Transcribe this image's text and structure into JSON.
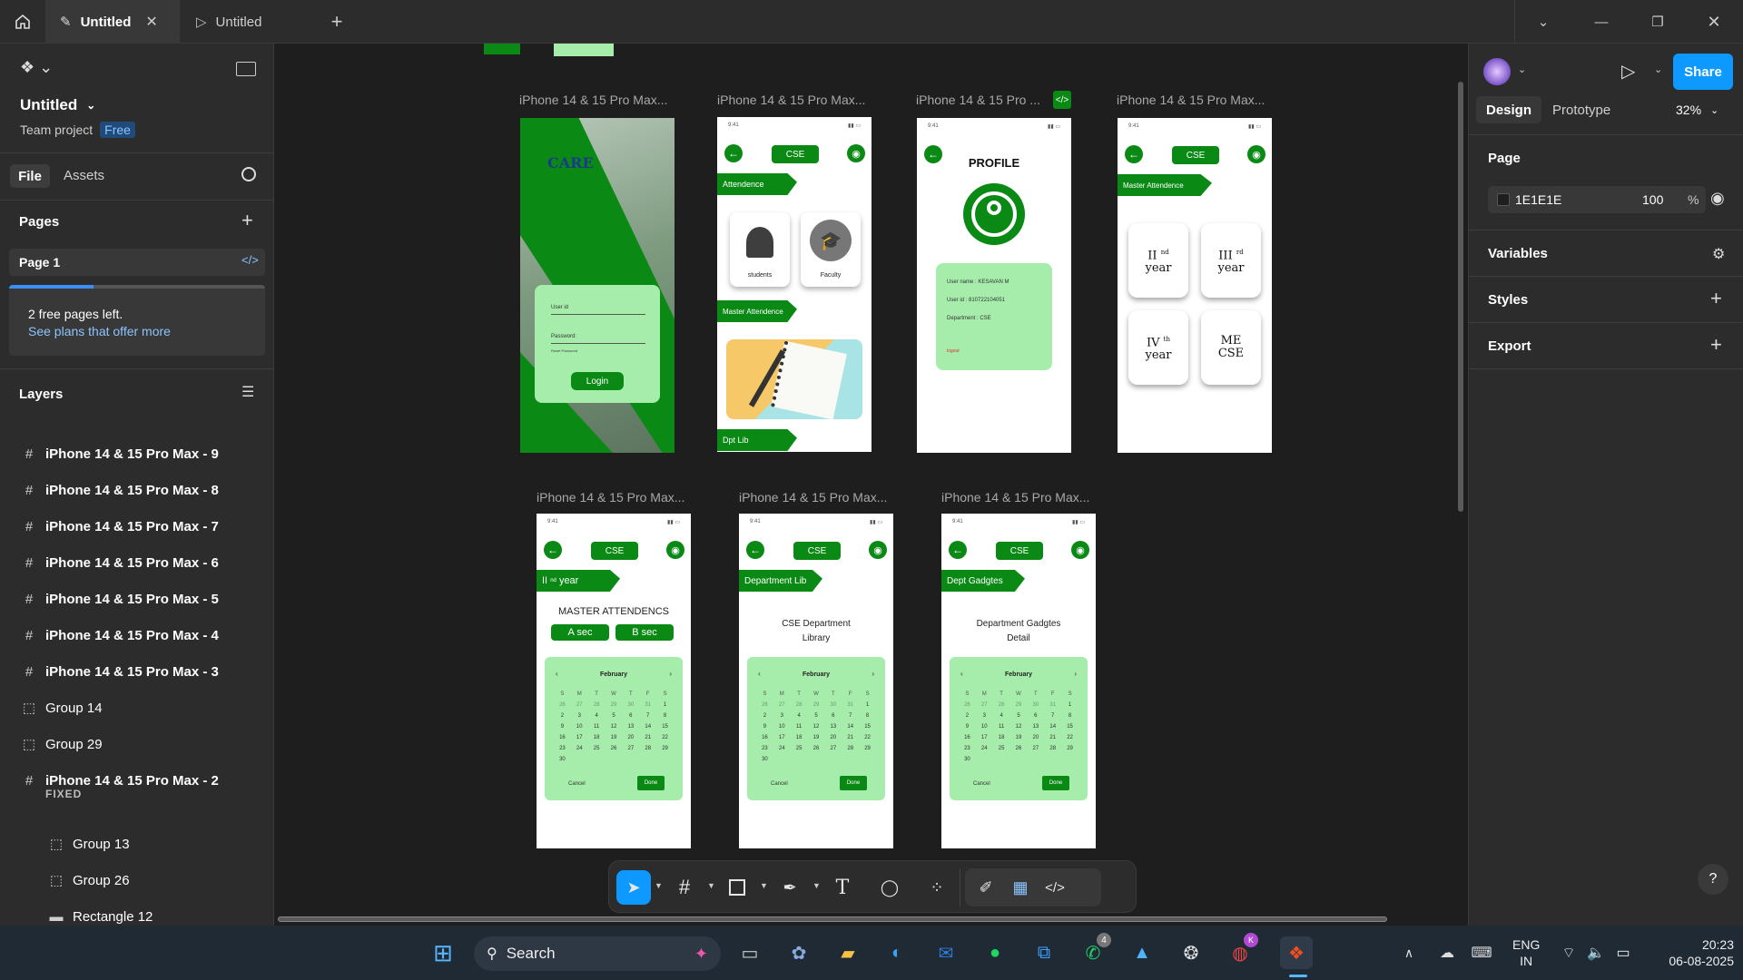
{
  "tabs": [
    {
      "label": "Untitled"
    },
    {
      "label": "Untitled"
    }
  ],
  "file": {
    "name": "Untitled",
    "project": "Team project",
    "plan": "Free",
    "tab_file": "File",
    "tab_assets": "Assets"
  },
  "pages": {
    "title": "Pages",
    "current": "Page 1",
    "banner": "2 free pages left.",
    "banner_link": "See plans that offer more",
    "progress": 0.33
  },
  "layers": {
    "title": "Layers",
    "items": [
      {
        "label": "iPhone 14 & 15 Pro Max - 9",
        "kind": "frame"
      },
      {
        "label": "iPhone 14 & 15 Pro Max - 8",
        "kind": "frame"
      },
      {
        "label": "iPhone 14 & 15 Pro Max - 7",
        "kind": "frame"
      },
      {
        "label": "iPhone 14 & 15 Pro Max - 6",
        "kind": "frame"
      },
      {
        "label": "iPhone 14 & 15 Pro Max - 5",
        "kind": "frame"
      },
      {
        "label": "iPhone 14 & 15 Pro Max - 4",
        "kind": "frame"
      },
      {
        "label": "iPhone 14 & 15 Pro Max - 3",
        "kind": "frame"
      },
      {
        "label": "Group 14",
        "kind": "group"
      },
      {
        "label": "Group 29",
        "kind": "group"
      },
      {
        "label": "iPhone 14 & 15 Pro Max - 2",
        "kind": "frame"
      }
    ],
    "fixed_label": "FIXED",
    "children": [
      {
        "label": "Group 13",
        "kind": "group"
      },
      {
        "label": "Group 26",
        "kind": "group"
      },
      {
        "label": "Rectangle 12",
        "kind": "rect"
      }
    ]
  },
  "right": {
    "share": "Share",
    "tab_design": "Design",
    "tab_prototype": "Prototype",
    "zoom": "32%",
    "page_title": "Page",
    "bg_color": "1E1E1E",
    "opacity": "100",
    "percent": "%",
    "variables": "Variables",
    "styles": "Styles",
    "export": "Export",
    "help": "?"
  },
  "canvas": {
    "labels": [
      "iPhone 14 & 15 Pro Max...",
      "iPhone 14 & 15 Pro Max...",
      "iPhone 14 & 15 Pro ...",
      "iPhone 14 & 15 Pro Max...",
      "iPhone 14 & 15 Pro Max...",
      "iPhone 14 & 15 Pro Max...",
      "iPhone 14 & 15 Pro Max..."
    ],
    "status_time": "9:41",
    "login": {
      "brand": "CARE",
      "user": "User id",
      "pass": "Password:",
      "reset": "Reset Password",
      "btn": "Login"
    },
    "home": {
      "cse": "CSE",
      "attendance": "Attendence",
      "students": "students",
      "faculty": "Faculty",
      "master": "Master Attendence",
      "dpt": "Dpt Lib"
    },
    "profile": {
      "title": "PROFILE",
      "name": "User name : KESAVAN M",
      "id": "User id : 810722104051",
      "dept": "Department : CSE",
      "logout": "logout"
    },
    "years": {
      "cse": "CSE",
      "master": "Master Attendence",
      "cards": [
        [
          "II",
          "nd",
          "year"
        ],
        [
          "III",
          "rd",
          "year"
        ],
        [
          "IV",
          "th",
          "year"
        ],
        [
          "ME",
          "",
          "CSE"
        ]
      ]
    },
    "f5": {
      "cse": "CSE",
      "ribbon_a": "II",
      "ribbon_sup": "nd",
      "ribbon_b": "year",
      "title": "MASTER ATTENDENCS",
      "a": "A sec",
      "b": "B sec"
    },
    "f6": {
      "cse": "CSE",
      "ribbon": "Department Lib",
      "title1": "CSE Department",
      "title2": "Library"
    },
    "f7": {
      "cse": "CSE",
      "ribbon": "Dept Gadgtes",
      "title1": "Department Gadgtes",
      "title2": "Detail"
    },
    "calendar": {
      "month": "February",
      "days": [
        "S",
        "M",
        "T",
        "W",
        "T",
        "F",
        "S"
      ],
      "dates": [
        "26",
        "27",
        "28",
        "29",
        "30",
        "31",
        "1",
        "2",
        "3",
        "4",
        "5",
        "6",
        "7",
        "8",
        "9",
        "10",
        "11",
        "12",
        "13",
        "14",
        "15",
        "16",
        "17",
        "18",
        "19",
        "20",
        "21",
        "22",
        "23",
        "24",
        "25",
        "26",
        "27",
        "28",
        "29",
        "30"
      ],
      "cancel": "Cancel",
      "done": "Done"
    }
  },
  "taskbar": {
    "search": "Search",
    "lang1": "ENG",
    "lang2": "IN",
    "time": "20:23",
    "date": "06-08-2025",
    "badge_whatsapp": "4",
    "badge_chrome": "K"
  }
}
